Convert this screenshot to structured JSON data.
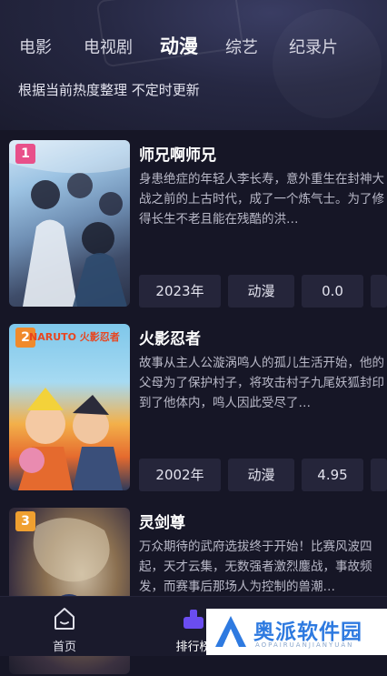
{
  "tabs": [
    {
      "label": "电影"
    },
    {
      "label": "电视剧"
    },
    {
      "label": "动漫"
    },
    {
      "label": "综艺"
    },
    {
      "label": "纪录片"
    }
  ],
  "active_tab": "动漫",
  "subtitle": "根据当前热度整理 不定时更新",
  "items": [
    {
      "rank": "1",
      "title": "师兄啊师兄",
      "description": "身患绝症的年轻人李长寿，意外重生在封神大战之前的上古时代，成了一个炼气士。为了修得长生不老且能在残酷的洪…",
      "year": "2023年",
      "genre": "动漫",
      "score": "0.0"
    },
    {
      "rank": "2",
      "title": "火影忍者",
      "description": "故事从主人公漩涡鸣人的孤儿生活开始，他的父母为了保护村子，将攻击村子九尾妖狐封印到了他体内，鸣人因此受尽了…",
      "year": "2002年",
      "genre": "动漫",
      "score": "4.95",
      "poster_text": "NARUTO 火影忍者"
    },
    {
      "rank": "3",
      "title": "灵剑尊",
      "description": "万众期待的武府选拔终于开始！比赛风波四起，天才云集，无数强者激烈鏖战，事故频发，而赛事后那场人为控制的兽潮…"
    }
  ],
  "bottom_nav": [
    {
      "label": "首页",
      "icon": "home-icon"
    },
    {
      "label": "排行榜",
      "icon": "ranking-icon"
    }
  ],
  "watermark": {
    "text": "奥派软件园",
    "sub": "AOPAIRUANJIANYUAN"
  },
  "colors": {
    "background": "#161626",
    "chip": "#25253a",
    "rank1": "#e8508a",
    "rank2": "#f08a2c",
    "rank3": "#f0a030",
    "nav_active": "#6a4df0"
  }
}
